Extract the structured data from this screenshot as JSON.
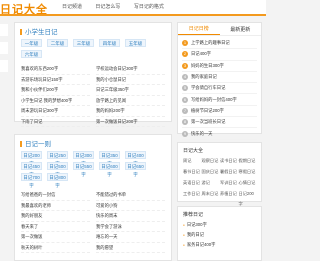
{
  "header": {
    "logo": "日记大全",
    "nav": [
      "日记频道",
      "日记怎么写",
      "写日记的格式"
    ]
  },
  "primary": {
    "title": "小学生日记",
    "tags": [
      "一年级",
      "二年级",
      "三年级",
      "四年级",
      "五年级",
      "六年级"
    ],
    "links": [
      "我喜欢的东西200字",
      "学校运动会日记300字",
      "去游乐场玩日记150字",
      "我的小仓鼠日记",
      "我和小伙伴们200字",
      "日记三年级350字",
      "小学生日记 我的梦想400字",
      "放学路上的见闻",
      "周末游玩日记300字",
      "我的妈妈200字",
      "下雨了日记",
      "第一次做饭日记200字",
      "暑假日记"
    ]
  },
  "secondary": {
    "title": "日记一则",
    "tags": [
      "日记200字",
      "日记250字",
      "日记300字",
      "日记350字",
      "日记400字",
      "日记450字",
      "日记500字",
      "日记550字",
      "日记600字",
      "日记650字",
      "日记700字",
      "日记800字"
    ],
    "links": [
      "写给爸爸的一封信",
      "不能错过的书单",
      "我最喜欢的老师",
      "可爱的小狗",
      "我的好朋友",
      "快乐的周末",
      "春天来了",
      "我学会了游泳",
      "第一次做饭",
      "难忘的一天",
      "秋天的树叶",
      "我的愿望"
    ]
  },
  "sidebar": {
    "tabs": [
      "日记日榜",
      "最新更新"
    ],
    "rank": [
      "上学路上的趣事日记",
      "日记400字",
      "妈妈的生日300字",
      "我的家庭日记",
      "学会骑自行车日记",
      "写给妈妈的一封信400字",
      "植树节日记200字",
      "第一次当班长日记",
      "快乐的一天"
    ],
    "grid_title": "日记大全",
    "grid": [
      "周记",
      "观察日记",
      "读书日记",
      "假期日记",
      "春节日记",
      "国庆日记",
      "暑假日记",
      "寒假日记",
      "英语日记",
      "游记",
      "军训日记",
      "心情日记",
      "工作日记",
      "周末日记",
      "养植日记",
      "日记200字"
    ],
    "recent_title": "推荐日记",
    "recent": [
      "日记300字",
      "我的日记",
      "家务日记400字"
    ]
  }
}
